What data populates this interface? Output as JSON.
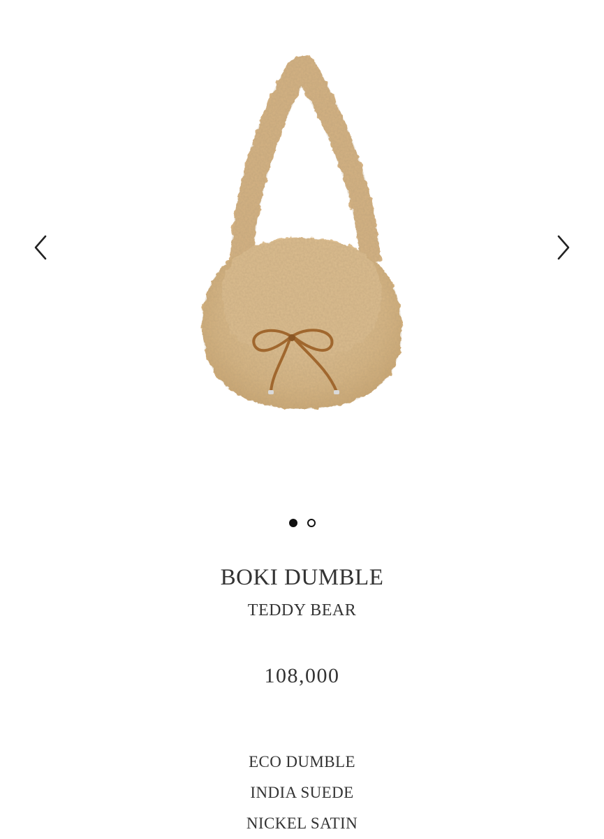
{
  "gallery": {
    "prev_icon": "chevron-left-icon",
    "next_icon": "chevron-right-icon",
    "image_subject": "teddy-bear-fleece-shoulder-bag",
    "dots_total": 2,
    "dots_active_index": 0
  },
  "product": {
    "name": "BOKI DUMBLE",
    "variant": "TEDDY BEAR",
    "price": "108,000",
    "materials": [
      "ECO DUMBLE",
      "INDIA SUEDE",
      "NICKEL SATIN"
    ]
  },
  "colors": {
    "text": "#333333",
    "dot": "#111111",
    "fleece": "#d8b98a",
    "strap": "#a0672e"
  }
}
